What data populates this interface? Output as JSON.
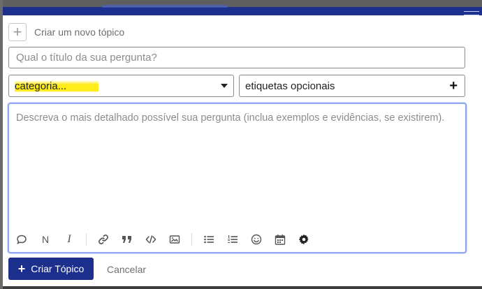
{
  "composer": {
    "header_title": "Criar um novo tópico",
    "title_placeholder": "Qual o título da sua pergunta?",
    "category_value": "categoria...",
    "tags_placeholder": "etiquetas opcionais",
    "editor_placeholder": "Descreva o mais detalhado possível sua pergunta (inclua exemplos e evidências, se existirem).",
    "toolbar": {
      "bold_label": "N",
      "italic_label": "I",
      "icons": [
        "quote-icon",
        "bold-icon",
        "italic-icon",
        "link-icon",
        "blockquote-icon",
        "code-icon",
        "image-icon",
        "bullet-list-icon",
        "numbered-list-icon",
        "emoji-icon",
        "calendar-icon",
        "gear-icon"
      ]
    },
    "create_button_label": "Criar Tópico",
    "cancel_label": "Cancelar"
  },
  "colors": {
    "primary": "#1c2f8c",
    "highlight": "#ffec1a",
    "editor_border": "#8fa6f0"
  }
}
